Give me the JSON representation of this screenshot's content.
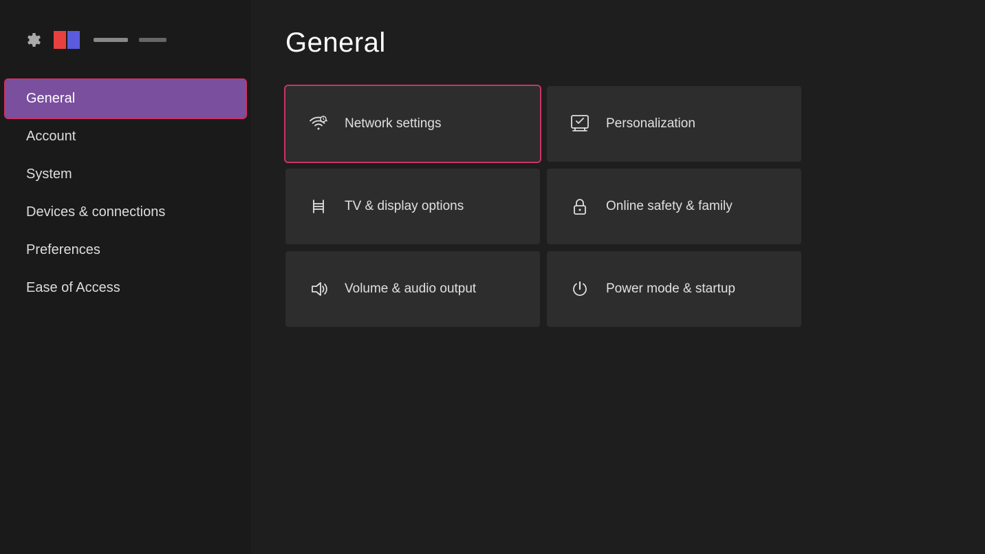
{
  "header": {
    "title": "General"
  },
  "sidebar": {
    "items": [
      {
        "id": "general",
        "label": "General",
        "active": true
      },
      {
        "id": "account",
        "label": "Account",
        "active": false
      },
      {
        "id": "system",
        "label": "System",
        "active": false
      },
      {
        "id": "devices-connections",
        "label": "Devices & connections",
        "active": false
      },
      {
        "id": "preferences",
        "label": "Preferences",
        "active": false
      },
      {
        "id": "ease-of-access",
        "label": "Ease of Access",
        "active": false
      }
    ]
  },
  "grid": {
    "items": [
      {
        "id": "network-settings",
        "label": "Network settings",
        "icon": "wifi-icon",
        "highlighted": true
      },
      {
        "id": "personalization",
        "label": "Personalization",
        "icon": "personalization-icon",
        "highlighted": false
      },
      {
        "id": "tv-display",
        "label": "TV & display options",
        "icon": "display-icon",
        "highlighted": false
      },
      {
        "id": "online-safety",
        "label": "Online safety & family",
        "icon": "lock-icon",
        "highlighted": false
      },
      {
        "id": "volume-audio",
        "label": "Volume & audio output",
        "icon": "volume-icon",
        "highlighted": false
      },
      {
        "id": "power-mode",
        "label": "Power mode & startup",
        "icon": "power-icon",
        "highlighted": false
      }
    ]
  }
}
